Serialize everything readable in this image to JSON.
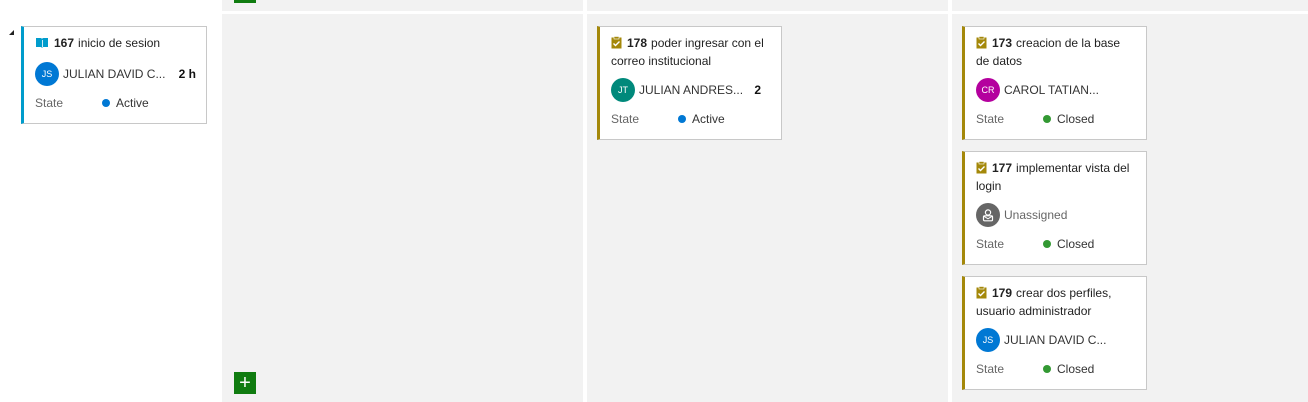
{
  "colors": {
    "pbi_accent": "#009ccc",
    "task_accent": "#a4880a",
    "active_dot": "#0078d4",
    "closed_dot": "#339933",
    "add_button": "#107c10"
  },
  "parent_card": {
    "icon": "book-icon",
    "id": "167",
    "title": "inicio de sesion",
    "assignee": {
      "initials": "JS",
      "name": "JULIAN DAVID C...",
      "color": "#0078d4"
    },
    "effort": "2 h",
    "state_label": "State",
    "state": "Active"
  },
  "columns": {
    "in_progress": {
      "cards": [
        {
          "icon": "clipboard-icon",
          "id": "178",
          "title": "poder ingresar con el correo institucional",
          "assignee": {
            "initials": "JT",
            "name": "JULIAN ANDRES...",
            "color": "#00897b"
          },
          "effort": "2",
          "state_label": "State",
          "state": "Active"
        }
      ]
    },
    "done": {
      "cards": [
        {
          "icon": "clipboard-icon",
          "id": "173",
          "title": "creacion de la base de datos",
          "assignee": {
            "initials": "CR",
            "name": "CAROL TATIAN...",
            "color": "#b4009e"
          },
          "state_label": "State",
          "state": "Closed"
        },
        {
          "icon": "clipboard-icon",
          "id": "177",
          "title": "implementar vista del login",
          "assignee": {
            "initials": "",
            "name": "Unassigned",
            "color": "#666666"
          },
          "state_label": "State",
          "state": "Closed"
        },
        {
          "icon": "clipboard-icon",
          "id": "179",
          "title": "crear dos perfiles, usuario administrador",
          "assignee": {
            "initials": "JS",
            "name": "JULIAN DAVID C...",
            "color": "#0078d4"
          },
          "state_label": "State",
          "state": "Closed"
        }
      ]
    }
  },
  "add_button": {
    "label": "+",
    "icon": "plus-icon"
  }
}
